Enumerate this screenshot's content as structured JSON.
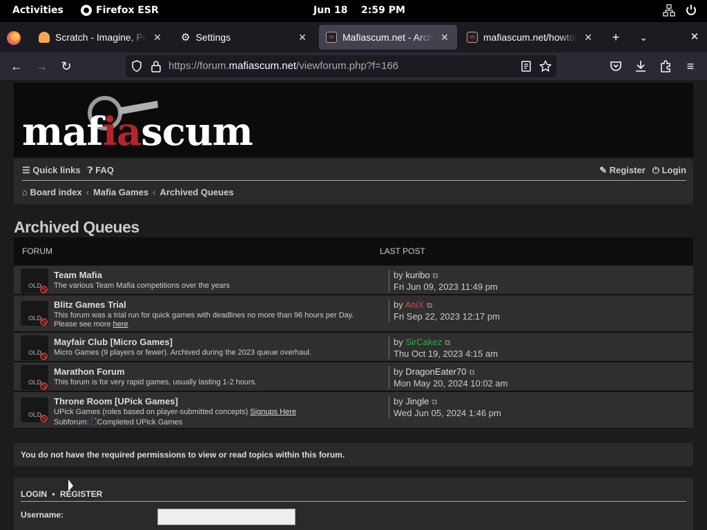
{
  "gnome": {
    "activities": "Activities",
    "app_name": "Firefox ESR",
    "date": "Jun 18",
    "time": "2:59 PM"
  },
  "tabs": [
    {
      "title": "Scratch - Imagine, Program, Share",
      "favicon": "scratch-cat-icon"
    },
    {
      "title": "Settings",
      "favicon": "gear-icon"
    },
    {
      "title": "Mafiascum.net - Archived Queues",
      "favicon": "mafiascum-icon",
      "active": true
    },
    {
      "title": "mafiascum.net/howtoplay",
      "favicon": "mafiascum-icon"
    }
  ],
  "url": {
    "prefix": "https://forum.",
    "domain": "mafiascum.net",
    "path": "/viewforum.php?f=166"
  },
  "site": {
    "logo_part1": "maf",
    "logo_part2": "ia",
    "logo_part3": "scum"
  },
  "nav": {
    "quick_links": "Quick links",
    "faq": "FAQ",
    "register": "Register",
    "login": "Login",
    "breadcrumbs": [
      "Board index",
      "Mafia Games",
      "Archived Queues"
    ]
  },
  "page_title": "Archived Queues",
  "table": {
    "col_forum": "Forum",
    "col_last_post": "Last Post",
    "icon_label": "OLD",
    "rows": [
      {
        "name": "Team Mafia",
        "desc": "The various Team Mafia competitions over the years",
        "by": "by",
        "user": "kuribo",
        "user_color": "#dddddd",
        "date": "Fri Jun 09, 2023 11:49 pm"
      },
      {
        "name": "Blitz Games Trial",
        "desc": "This forum was a trial run for quick games with deadlines no more than 96 hours per Day. Please see more",
        "desc_link": "here",
        "by": "by",
        "user": "AniX",
        "user_color": "#e0443a",
        "date": "Fri Sep 22, 2023 12:17 pm"
      },
      {
        "name": "Mayfair Club [Micro Games]",
        "desc": "Micro Games (9 players or fewer). Archived during the 2023 queue overhaul.",
        "by": "by",
        "user": "SirCakez",
        "user_color": "#2fa84f",
        "date": "Thu Oct 19, 2023 4:15 am"
      },
      {
        "name": "Marathon Forum",
        "desc": "This forum is for very rapid games, usually lasting 1-2 hours.",
        "by": "by",
        "user": "DragonEater70",
        "user_color": "#dddddd",
        "date": "Mon May 20, 2024 10:02 am"
      },
      {
        "name": "Throne Room [UPick Games]",
        "desc": "UPick Games (roles based on player-submitted concepts)",
        "desc_link": "Signups Here",
        "subforum_label": "Subforum:",
        "subforum": "Completed UPick Games",
        "by": "by",
        "user": "Jingle",
        "user_color": "#dddddd",
        "date": "Wed Jun 05, 2024 1:46 pm"
      }
    ]
  },
  "notice": "You do not have the required permissions to view or read topics within this forum.",
  "login_box": {
    "login": "LOGIN",
    "sep": "•",
    "register": "REGISTER",
    "username_label": "Username:"
  }
}
